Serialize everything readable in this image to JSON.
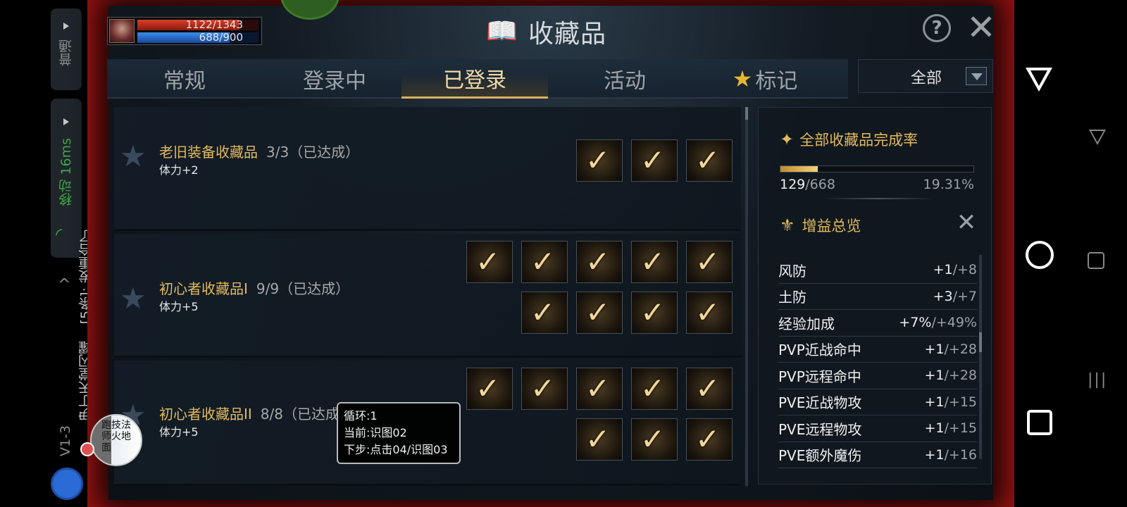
{
  "overlay": {
    "mode_label": "普通",
    "network_label": "移动 16ms",
    "message": "[5条]: 发重合了",
    "app_name": "伊丁天堂闪耀",
    "version": "V1-3",
    "float_ball_text": "跑技法师火地面"
  },
  "player": {
    "hp_text": "1122/1343",
    "hp_fraction": 0.835,
    "mp_text": "688/900",
    "mp_fraction": 0.764
  },
  "header": {
    "title": "收藏品"
  },
  "tabs": [
    {
      "label": "常规"
    },
    {
      "label": "登录中"
    },
    {
      "label": "已登录"
    },
    {
      "label": "活动"
    },
    {
      "label": "标记"
    }
  ],
  "active_tab": "已登录",
  "filter": {
    "selected": "全部"
  },
  "collections": [
    {
      "title": "老旧装备收藏品",
      "progress": "3/3（已达成）",
      "stat": "体力+2",
      "slots": 3
    },
    {
      "title": "初心者收藏品I",
      "progress": "9/9（已达成）",
      "stat": "体力+5",
      "slots": 9
    },
    {
      "title": "初心者收藏品II",
      "progress": "8/8（已达成）",
      "stat": "体力+5",
      "slots": 8
    }
  ],
  "tooltip": {
    "line1": "循环:1",
    "line2": "当前:识图02",
    "line3": "下步:点击04/识图03"
  },
  "summary": {
    "title": "全部收藏品完成率",
    "count": "129",
    "total": "/668",
    "percent": "19.31%",
    "fraction": 0.1931
  },
  "buffs": {
    "title": "增益总览",
    "items": [
      {
        "name": "风防",
        "value": "+1",
        "max": "/+8"
      },
      {
        "name": "土防",
        "value": "+3",
        "max": "/+7"
      },
      {
        "name": "经验加成",
        "value": "+7%",
        "max": "/+49%"
      },
      {
        "name": "PVP近战命中",
        "value": "+1",
        "max": "/+28"
      },
      {
        "name": "PVP远程命中",
        "value": "+1",
        "max": "/+28"
      },
      {
        "name": "PVE近战物攻",
        "value": "+1",
        "max": "/+15"
      },
      {
        "name": "PVE远程物攻",
        "value": "+1",
        "max": "/+15"
      },
      {
        "name": "PVE额外魔伤",
        "value": "+1",
        "max": "/+16"
      }
    ]
  },
  "colors": {
    "frame": "#a81414",
    "gold": "#e3b95c",
    "accent": "#f0d9a4"
  }
}
